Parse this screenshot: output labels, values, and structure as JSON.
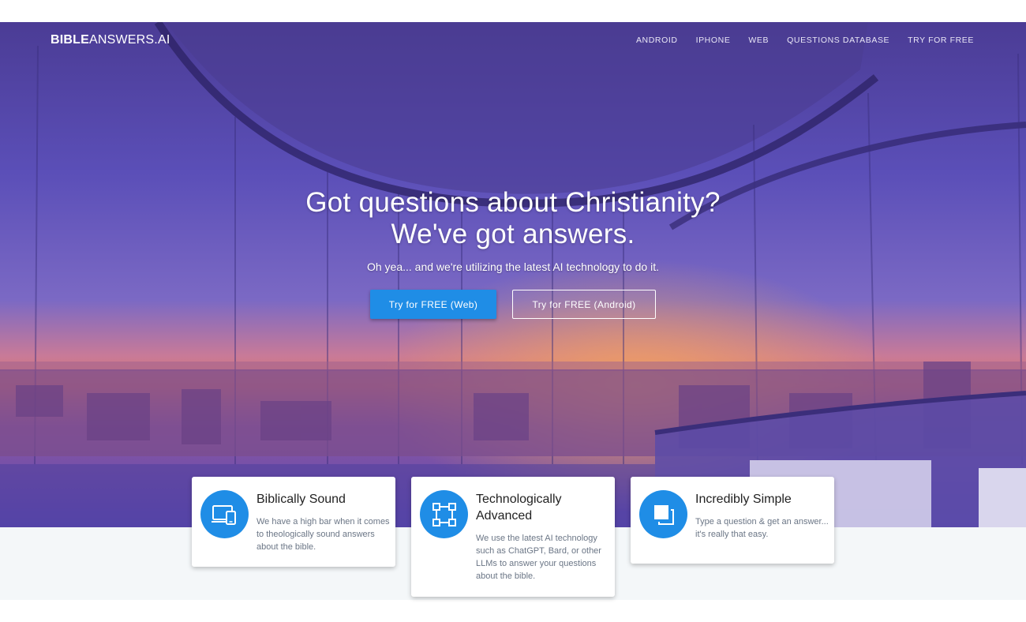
{
  "brand": {
    "bold": "BIBLE",
    "light": "ANSWERS.AI"
  },
  "nav": {
    "items": [
      {
        "label": "ANDROID"
      },
      {
        "label": "IPHONE"
      },
      {
        "label": "WEB"
      },
      {
        "label": "QUESTIONS DATABASE"
      },
      {
        "label": "TRY FOR FREE"
      }
    ]
  },
  "hero": {
    "headline_line1": "Got questions about Christianity?",
    "headline_line2": "We've got answers.",
    "subline": "Oh yea... and we're utilizing the latest AI technology to do it.",
    "primary_button": "Try for FREE (Web)",
    "secondary_button": "Try for FREE (Android)"
  },
  "features": [
    {
      "icon": "monitor-phone-icon",
      "title": "Biblically Sound",
      "title_line2": "",
      "desc_lines": [
        "We have a high bar when it comes",
        "to theologically sound answers",
        "about the bible."
      ]
    },
    {
      "icon": "vector-square-icon",
      "title": "Technologically",
      "title_line2": "Advanced",
      "desc_lines": [
        "We use the latest AI technology",
        "such as ChatGPT, Bard, or other",
        "LLMs to answer your questions",
        "about the bible."
      ]
    },
    {
      "icon": "layers-icon",
      "title": "Incredibly Simple",
      "title_line2": "",
      "desc_lines": [
        "Type a question & get an answer...",
        "it's really that easy."
      ]
    }
  ],
  "colors": {
    "accent": "#1f8de6",
    "hero_overlay": "#5c4cb8",
    "lower_band": "#f4f7f9"
  }
}
